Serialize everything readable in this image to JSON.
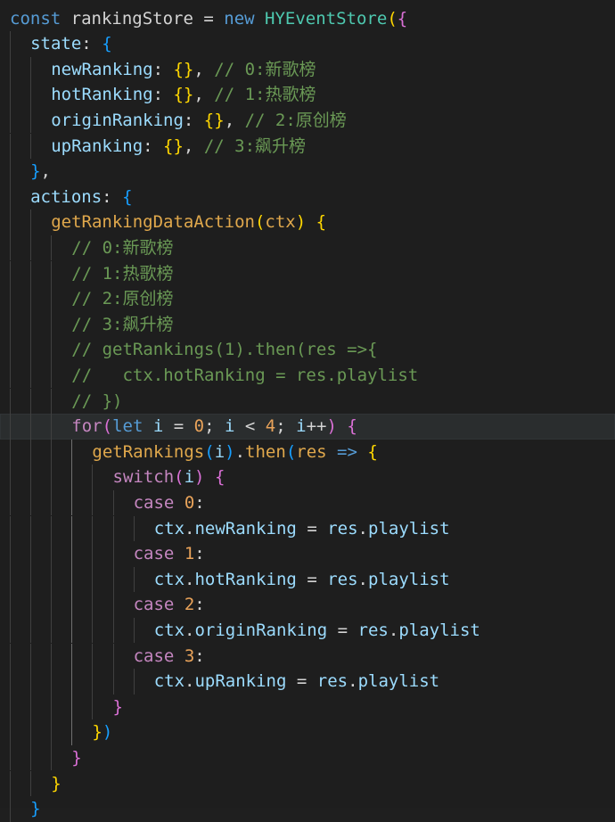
{
  "editor": {
    "theme_colors": {
      "background": "#1e1e1e",
      "keyword": "#569cd6",
      "control": "#c586c0",
      "variable": "#9cdcfe",
      "class": "#4ec9b0",
      "function": "#dcdcaa",
      "number": "#b5cea8",
      "comment": "#6a9955",
      "bracket1": "#ffd700",
      "bracket2": "#da70d6",
      "bracket3": "#179fff"
    },
    "current_line": 16,
    "lines": [
      {
        "indent": 0,
        "tokens": [
          [
            "const",
            "kw"
          ],
          [
            " rankingStore ",
            "pn"
          ],
          [
            "=",
            "op"
          ],
          [
            " ",
            "pn"
          ],
          [
            "new",
            "kw"
          ],
          [
            " ",
            "pn"
          ],
          [
            "HYEventStore",
            "cls"
          ],
          [
            "(",
            "b1"
          ],
          [
            "{",
            "b2"
          ]
        ]
      },
      {
        "indent": 1,
        "tokens": [
          [
            "state",
            "prop"
          ],
          [
            ": ",
            "pn"
          ],
          [
            "{",
            "b3"
          ]
        ]
      },
      {
        "indent": 2,
        "tokens": [
          [
            "newRanking",
            "prop"
          ],
          [
            ": ",
            "pn"
          ],
          [
            "{}",
            "b1"
          ],
          [
            ", ",
            "pn"
          ],
          [
            "// 0:新歌榜",
            "cm"
          ]
        ]
      },
      {
        "indent": 2,
        "tokens": [
          [
            "hotRanking",
            "prop"
          ],
          [
            ": ",
            "pn"
          ],
          [
            "{}",
            "b1"
          ],
          [
            ", ",
            "pn"
          ],
          [
            "// 1:热歌榜",
            "cm"
          ]
        ]
      },
      {
        "indent": 2,
        "tokens": [
          [
            "originRanking",
            "prop"
          ],
          [
            ": ",
            "pn"
          ],
          [
            "{}",
            "b1"
          ],
          [
            ", ",
            "pn"
          ],
          [
            "// 2:原创榜",
            "cm"
          ]
        ]
      },
      {
        "indent": 2,
        "tokens": [
          [
            "upRanking",
            "prop"
          ],
          [
            ": ",
            "pn"
          ],
          [
            "{}",
            "b1"
          ],
          [
            ", ",
            "pn"
          ],
          [
            "// 3:飙升榜",
            "cm"
          ]
        ]
      },
      {
        "indent": 1,
        "tokens": [
          [
            "}",
            "b3"
          ],
          [
            ",",
            "pn"
          ]
        ]
      },
      {
        "indent": 1,
        "tokens": [
          [
            "actions",
            "prop"
          ],
          [
            ": ",
            "pn"
          ],
          [
            "{",
            "b3"
          ]
        ]
      },
      {
        "indent": 2,
        "tokens": [
          [
            "getRankingDataAction",
            "fn2"
          ],
          [
            "(",
            "b1"
          ],
          [
            "ctx",
            "fn2"
          ],
          [
            ")",
            "b1"
          ],
          [
            " ",
            "pn"
          ],
          [
            "{",
            "b1"
          ]
        ]
      },
      {
        "indent": 3,
        "tokens": [
          [
            "// 0:新歌榜",
            "cm"
          ]
        ]
      },
      {
        "indent": 3,
        "tokens": [
          [
            "// 1:热歌榜",
            "cm"
          ]
        ]
      },
      {
        "indent": 3,
        "tokens": [
          [
            "// 2:原创榜",
            "cm"
          ]
        ]
      },
      {
        "indent": 3,
        "tokens": [
          [
            "// 3:飙升榜",
            "cm"
          ]
        ]
      },
      {
        "indent": 3,
        "tokens": [
          [
            "// getRankings(1).then(res =>{",
            "cm"
          ]
        ]
      },
      {
        "indent": 3,
        "tokens": [
          [
            "//   ctx.hotRanking = res.playlist",
            "cm"
          ]
        ]
      },
      {
        "indent": 3,
        "tokens": [
          [
            "// })",
            "cm"
          ]
        ]
      },
      {
        "indent": 3,
        "tokens": [
          [
            "for",
            "ctl"
          ],
          [
            "(",
            "b2"
          ],
          [
            "let",
            "kw"
          ],
          [
            " i ",
            "var"
          ],
          [
            "=",
            "op"
          ],
          [
            " ",
            "pn"
          ],
          [
            "0",
            "numo"
          ],
          [
            "; ",
            "pn"
          ],
          [
            "i ",
            "var"
          ],
          [
            "<",
            "op"
          ],
          [
            " ",
            "pn"
          ],
          [
            "4",
            "numo"
          ],
          [
            "; ",
            "pn"
          ],
          [
            "i",
            "var"
          ],
          [
            "++",
            "op"
          ],
          [
            ")",
            "b2"
          ],
          [
            " ",
            "pn"
          ],
          [
            "{",
            "b2"
          ]
        ]
      },
      {
        "indent": 4,
        "tokens": [
          [
            "getRankings",
            "fn2"
          ],
          [
            "(",
            "b3"
          ],
          [
            "i",
            "var"
          ],
          [
            ")",
            "b3"
          ],
          [
            ".",
            "pn"
          ],
          [
            "then",
            "fn2"
          ],
          [
            "(",
            "b3"
          ],
          [
            "res",
            "fn2"
          ],
          [
            " ",
            "pn"
          ],
          [
            "=>",
            "kw"
          ],
          [
            " ",
            "pn"
          ],
          [
            "{",
            "b1"
          ]
        ]
      },
      {
        "indent": 5,
        "tokens": [
          [
            "switch",
            "ctl"
          ],
          [
            "(",
            "b2"
          ],
          [
            "i",
            "var"
          ],
          [
            ")",
            "b2"
          ],
          [
            " ",
            "pn"
          ],
          [
            "{",
            "b2"
          ]
        ]
      },
      {
        "indent": 6,
        "tokens": [
          [
            "case",
            "ctl"
          ],
          [
            " ",
            "pn"
          ],
          [
            "0",
            "numo"
          ],
          [
            ":",
            "pn"
          ]
        ]
      },
      {
        "indent": 7,
        "tokens": [
          [
            "ctx",
            "var"
          ],
          [
            ".",
            "pn"
          ],
          [
            "newRanking",
            "var"
          ],
          [
            " ",
            "pn"
          ],
          [
            "=",
            "op"
          ],
          [
            " ",
            "pn"
          ],
          [
            "res",
            "var"
          ],
          [
            ".",
            "pn"
          ],
          [
            "playlist",
            "var"
          ]
        ]
      },
      {
        "indent": 6,
        "tokens": [
          [
            "case",
            "ctl"
          ],
          [
            " ",
            "pn"
          ],
          [
            "1",
            "numo"
          ],
          [
            ":",
            "pn"
          ]
        ]
      },
      {
        "indent": 7,
        "tokens": [
          [
            "ctx",
            "var"
          ],
          [
            ".",
            "pn"
          ],
          [
            "hotRanking",
            "var"
          ],
          [
            " ",
            "pn"
          ],
          [
            "=",
            "op"
          ],
          [
            " ",
            "pn"
          ],
          [
            "res",
            "var"
          ],
          [
            ".",
            "pn"
          ],
          [
            "playlist",
            "var"
          ]
        ]
      },
      {
        "indent": 6,
        "tokens": [
          [
            "case",
            "ctl"
          ],
          [
            " ",
            "pn"
          ],
          [
            "2",
            "numo"
          ],
          [
            ":",
            "pn"
          ]
        ]
      },
      {
        "indent": 7,
        "tokens": [
          [
            "ctx",
            "var"
          ],
          [
            ".",
            "pn"
          ],
          [
            "originRanking",
            "var"
          ],
          [
            " ",
            "pn"
          ],
          [
            "=",
            "op"
          ],
          [
            " ",
            "pn"
          ],
          [
            "res",
            "var"
          ],
          [
            ".",
            "pn"
          ],
          [
            "playlist",
            "var"
          ]
        ]
      },
      {
        "indent": 6,
        "tokens": [
          [
            "case",
            "ctl"
          ],
          [
            " ",
            "pn"
          ],
          [
            "3",
            "numo"
          ],
          [
            ":",
            "pn"
          ]
        ]
      },
      {
        "indent": 7,
        "tokens": [
          [
            "ctx",
            "var"
          ],
          [
            ".",
            "pn"
          ],
          [
            "upRanking",
            "var"
          ],
          [
            " ",
            "pn"
          ],
          [
            "=",
            "op"
          ],
          [
            " ",
            "pn"
          ],
          [
            "res",
            "var"
          ],
          [
            ".",
            "pn"
          ],
          [
            "playlist",
            "var"
          ]
        ]
      },
      {
        "indent": 5,
        "tokens": [
          [
            "}",
            "b2"
          ]
        ]
      },
      {
        "indent": 4,
        "tokens": [
          [
            "}",
            "b1"
          ],
          [
            ")",
            "b3"
          ]
        ]
      },
      {
        "indent": 3,
        "tokens": [
          [
            "}",
            "b2"
          ]
        ]
      },
      {
        "indent": 2,
        "tokens": [
          [
            "}",
            "b1"
          ]
        ]
      },
      {
        "indent": 1,
        "tokens": [
          [
            "}",
            "b3"
          ]
        ]
      }
    ]
  }
}
